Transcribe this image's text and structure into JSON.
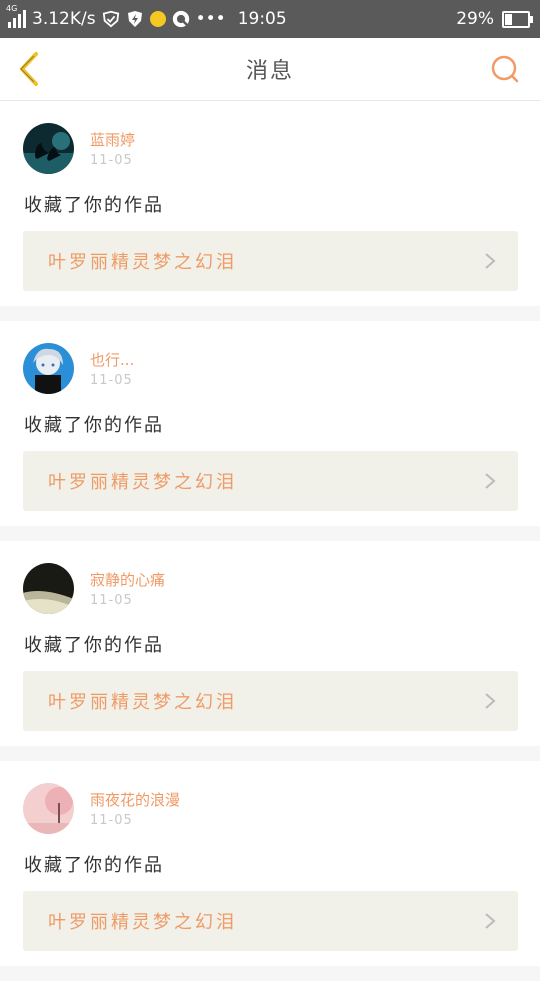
{
  "status_bar": {
    "network_type": "4G",
    "speed": "3.12K/s",
    "time": "19:05",
    "battery": "29%",
    "battery_level": 0.29
  },
  "navbar": {
    "title": "消息"
  },
  "colors": {
    "accent": "#f09a66",
    "back_icon": "#f0c22a",
    "card_link_bg": "#f1f1ea"
  },
  "notifications": [
    {
      "username": "蓝雨婷",
      "date": "11-05",
      "action": "收藏了你的作品",
      "work_title": "叶罗丽精灵梦之幻泪",
      "avatar_icon": "swan-avatar"
    },
    {
      "username": "也行...",
      "date": "11-05",
      "action": "收藏了你的作品",
      "work_title": "叶罗丽精灵梦之幻泪",
      "avatar_icon": "anime-boy-avatar"
    },
    {
      "username": "寂静的心痛",
      "date": "11-05",
      "action": "收藏了你的作品",
      "work_title": "叶罗丽精灵梦之幻泪",
      "avatar_icon": "dark-photo-avatar"
    },
    {
      "username": "雨夜花的浪漫",
      "date": "11-05",
      "action": "收藏了你的作品",
      "work_title": "叶罗丽精灵梦之幻泪",
      "avatar_icon": "pink-tree-avatar"
    }
  ]
}
